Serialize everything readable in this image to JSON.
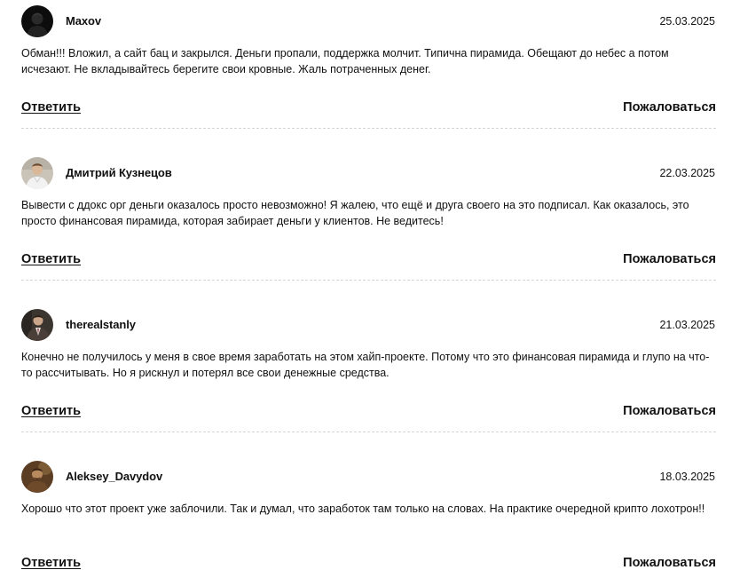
{
  "comments": [
    {
      "author": "Maxov",
      "date": "25.03.2025",
      "text": "Обман!!! Вложил, а сайт бац и закрылся. Деньги пропали, поддержка молчит. Типична пирамида. Обещают до небес а потом исчезают. Не вкладывайтесь берегите свои кровные. Жаль потраченных денег.",
      "reply_label": "Ответить",
      "report_label": "Пожаловаться",
      "avatar_icon": "avatar-dark-user-icon"
    },
    {
      "author": "Дмитрий Кузнецов",
      "date": "22.03.2025",
      "text": "Вывести с ддокс орг деньги оказалось просто невозможно! Я жалею, что ещё и друга своего на это подписал. Как оказалось, это просто финансовая пирамида, которая забирает деньги у клиентов. Не ведитесь!",
      "reply_label": "Ответить",
      "report_label": "Пожаловаться",
      "avatar_icon": "avatar-photo-user-icon"
    },
    {
      "author": "therealstanly",
      "date": "21.03.2025",
      "text": "Конечно не получилось у меня в свое время заработать на этом хайп-проекте. Потому что это финансовая пирамида и глупо на что-то рассчитывать. Но я рискнул и потерял все свои денежные средства.",
      "reply_label": "Ответить",
      "report_label": "Пожаловаться",
      "avatar_icon": "avatar-photo-user-icon"
    },
    {
      "author": "Aleksey_Davydov",
      "date": "18.03.2025",
      "text": "Хорошо что этот проект уже заблочили. Так и думал, что заработок там только на словах. На практике очередной крипто лохотрон!!",
      "reply_label": "Ответить",
      "report_label": "Пожаловаться",
      "avatar_icon": "avatar-photo-user-icon"
    }
  ],
  "colors": {
    "text": "#111111",
    "divider": "#d4d4d4",
    "background": "#ffffff"
  }
}
